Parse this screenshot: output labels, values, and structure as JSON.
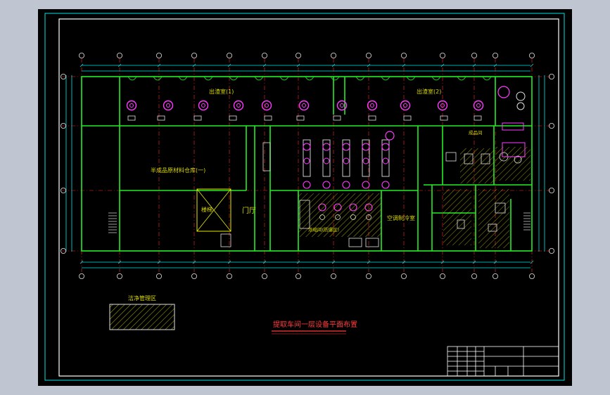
{
  "drawing": {
    "title": "提取车间一层设备平面布置",
    "colors": {
      "background": "#000000",
      "frame": "#ffffff",
      "wall": "#22ee22",
      "axis": "#ff2a2a",
      "dimension": "#00e5e5",
      "label": "#d8d800",
      "equipment_magenta": "#ff3aff",
      "hatch": "#e8e800"
    },
    "rooms": {
      "extraction_1": "出渣室(1)",
      "extraction_2": "出渣室(2)",
      "raw_storage": "半成品原材料仓库(一)",
      "stair_hall": "楼梯",
      "foyer": "门厅",
      "control": "空调制冷室",
      "concentration": "浓缩间(防爆区)",
      "north_right": "成品间"
    },
    "legend": {
      "label": "洁净管理区"
    }
  }
}
